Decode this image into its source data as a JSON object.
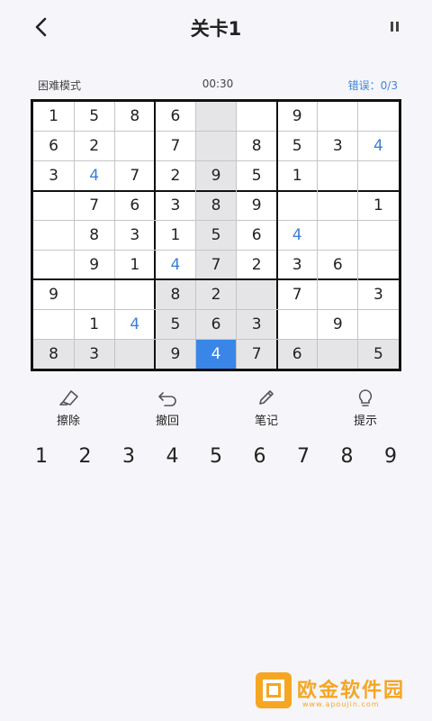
{
  "header": {
    "title": "关卡1",
    "back_icon": "back-arrow-icon",
    "pause_icon": "pause-icon"
  },
  "status": {
    "mode": "困难模式",
    "timer": "00:30",
    "errors": "错误：0/3"
  },
  "colors": {
    "accent": "#3a86e8",
    "user_digit": "#3c7fd4",
    "highlight": "#e5e5e7",
    "watermark": "#f5a623"
  },
  "board": {
    "rows": [
      [
        "1",
        "5",
        "8",
        "6",
        "",
        "",
        "9",
        "",
        ""
      ],
      [
        "6",
        "2",
        "",
        "7",
        "",
        "8",
        "5",
        "3",
        "4"
      ],
      [
        "3",
        "4",
        "7",
        "2",
        "9",
        "5",
        "1",
        "",
        ""
      ],
      [
        "",
        "7",
        "6",
        "3",
        "8",
        "9",
        "",
        "",
        "1"
      ],
      [
        "",
        "8",
        "3",
        "1",
        "5",
        "6",
        "4",
        "",
        ""
      ],
      [
        "",
        "9",
        "1",
        "4",
        "7",
        "2",
        "3",
        "6",
        ""
      ],
      [
        "9",
        "",
        "",
        "8",
        "2",
        "",
        "7",
        "",
        "3"
      ],
      [
        "",
        "1",
        "4",
        "5",
        "6",
        "3",
        "",
        "9",
        ""
      ],
      [
        "8",
        "3",
        "",
        "9",
        "4",
        "7",
        "6",
        "",
        "5"
      ]
    ],
    "user_entered": [
      [
        1,
        8
      ],
      [
        2,
        1
      ],
      [
        4,
        6
      ],
      [
        5,
        3
      ],
      [
        7,
        2
      ],
      [
        8,
        4
      ]
    ],
    "selected": [
      8,
      4
    ]
  },
  "tools": [
    {
      "label": "擦除",
      "icon": "eraser-icon"
    },
    {
      "label": "撤回",
      "icon": "undo-icon"
    },
    {
      "label": "笔记",
      "icon": "pencil-icon"
    },
    {
      "label": "提示",
      "icon": "lightbulb-icon"
    }
  ],
  "numpad": [
    "1",
    "2",
    "3",
    "4",
    "5",
    "6",
    "7",
    "8",
    "9"
  ],
  "watermark": {
    "name": "欧金软件园",
    "url": "www.apoujin.com"
  }
}
